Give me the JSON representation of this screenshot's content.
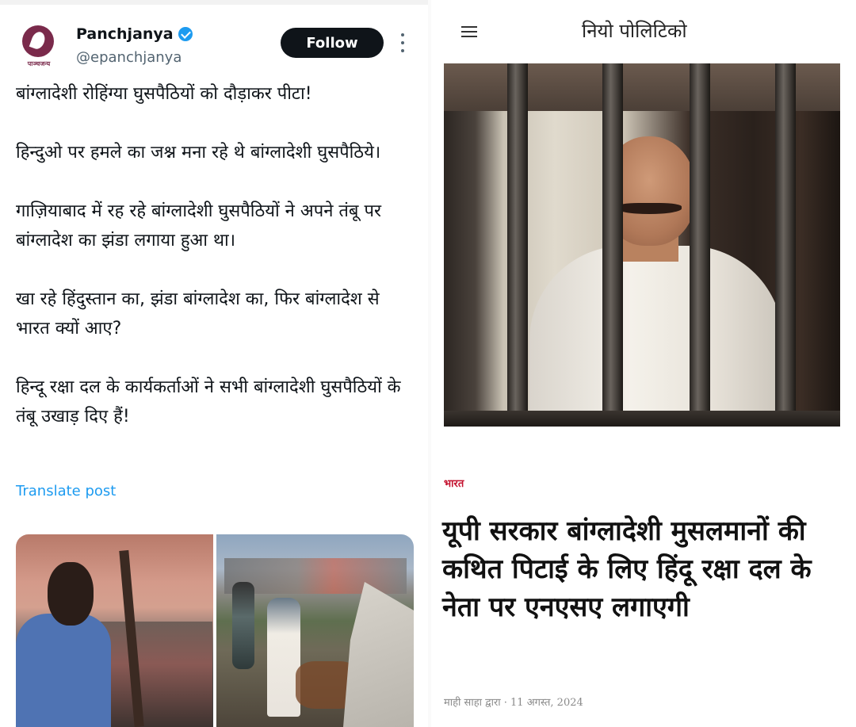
{
  "tweet": {
    "brand_label": "पाञ्चजन्य",
    "display_name": "Panchjanya",
    "handle": "@epanchjanya",
    "follow_label": "Follow",
    "paragraphs": [
      "बांग्लादेशी रोहिंग्या घुसपैठियों को दौड़ाकर पीटा!",
      "हिन्दुओ पर हमले का जश्न मना रहे थे बांग्लादेशी घुसपैठिये।",
      "गाज़ियाबाद में रह रहे बांग्लादेशी घुसपैठियों ने अपने तंबू पर बांग्लादेश का झंडा लगाया हुआ था।",
      "खा रहे हिंदुस्तान का, झंडा बांग्लादेश का, फिर बांग्लादेश से भारत क्यों आए?",
      "हिन्दू रक्षा दल के कार्यकर्ताओं ने सभी बांग्लादेशी घुसपैठियों के तंबू उखाड़ दिए हैं!"
    ],
    "translate_label": "Translate post",
    "colors": {
      "link": "#1d9bf0",
      "verified": "#1d9bf0",
      "follow_bg": "#0f1419"
    }
  },
  "article": {
    "site_title": "नियो पोलिटिको",
    "category": "भारत",
    "headline": "यूपी सरकार बांग्लादेशी मुसलमानों की कथित पिटाई के लिए हिंदू रक्षा दल के नेता पर एनएसए लगाएगी",
    "byline": "माही साहा द्वारा · 11 अगस्त, 2024",
    "colors": {
      "category": "#c4122f"
    }
  },
  "icons": [
    "verified-icon",
    "more-options-icon",
    "menu-icon"
  ]
}
